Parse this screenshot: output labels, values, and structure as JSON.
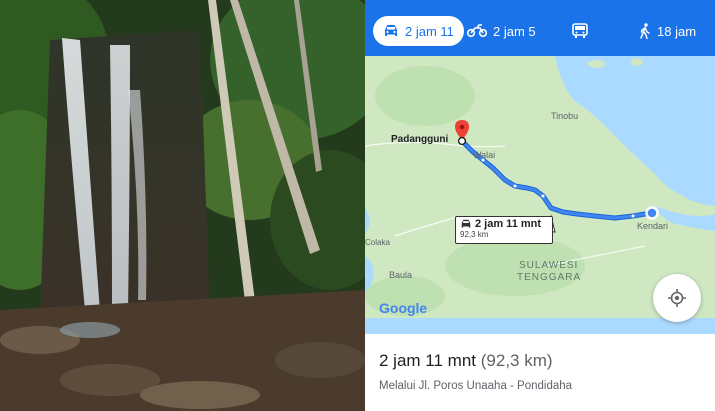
{
  "modes": [
    {
      "label": "2 jam 11",
      "icon": "car-icon",
      "active": true
    },
    {
      "label": "2 jam 5",
      "icon": "motorcycle-icon",
      "active": false
    },
    {
      "label": "",
      "icon": "bus-icon",
      "active": false
    },
    {
      "label": "18 jam",
      "icon": "walk-icon",
      "active": false
    }
  ],
  "map": {
    "places": {
      "origin": "Padangguni",
      "walai": "Walai",
      "tinobu": "Tinobu",
      "kendari": "Kendari",
      "colaka": "Colaka",
      "baula": "Baula",
      "region_line1": "SULAWESI",
      "region_line2": "TENGGARA"
    },
    "route_callout": {
      "time": "2 jam 11 mnt",
      "distance": "92,3 km"
    },
    "logo": "Google",
    "colors": {
      "route": "#4285f4",
      "water": "#aadaff",
      "land": "#cfe8c2",
      "accent": "#1a73e8"
    }
  },
  "summary": {
    "time": "2 jam 11 mnt",
    "distance": "(92,3 km)",
    "via": "Melalui Jl. Poros Unaaha - Pondidaha"
  }
}
